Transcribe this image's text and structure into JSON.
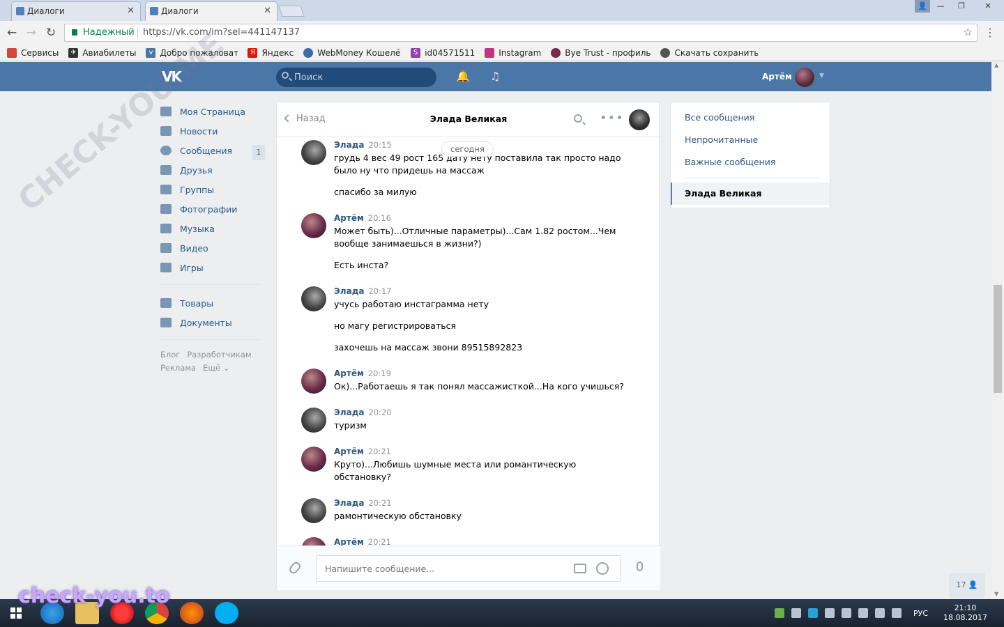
{
  "browser": {
    "tabs": [
      {
        "label": "Диалоги",
        "active": false
      },
      {
        "label": "Диалоги",
        "active": true
      }
    ],
    "secure_label": "Надежный",
    "url": "https://vk.com/im?sel=441147137",
    "bookmarks": [
      {
        "label": "Сервисы",
        "icon": "apps-grid-icon",
        "color": "#d14836"
      },
      {
        "label": "Авиабилеты",
        "icon": "plane-icon",
        "color": "#333333"
      },
      {
        "label": "Добро пожаловать",
        "icon": "vk-icon",
        "color": "#4a76a8"
      },
      {
        "label": "Яндекс",
        "icon": "yandex-icon",
        "color": "#e61400"
      },
      {
        "label": "WebMoney Кошелёк",
        "icon": "webmoney-icon",
        "color": "#3a6ea5"
      },
      {
        "label": "id04571511",
        "icon": "s-icon",
        "color": "#8e44ad"
      },
      {
        "label": "Instagram",
        "icon": "instagram-icon",
        "color": "#c13584"
      },
      {
        "label": "Bye Trust - профиль",
        "icon": "bye-trust-icon",
        "color": "#7a2a4a"
      },
      {
        "label": "Скачать сохранить с",
        "icon": "download-icon",
        "color": "#555555"
      }
    ]
  },
  "vk": {
    "header": {
      "search_placeholder": "Поиск",
      "username": "Артём"
    },
    "nav": [
      {
        "label": "Моя Страница",
        "icon": "home-icon"
      },
      {
        "label": "Новости",
        "icon": "news-icon"
      },
      {
        "label": "Сообщения",
        "icon": "messages-icon",
        "badge": "1"
      },
      {
        "label": "Друзья",
        "icon": "friends-icon"
      },
      {
        "label": "Группы",
        "icon": "groups-icon"
      },
      {
        "label": "Фотографии",
        "icon": "photos-icon"
      },
      {
        "label": "Музыка",
        "icon": "music-icon"
      },
      {
        "label": "Видео",
        "icon": "video-icon"
      },
      {
        "label": "Игры",
        "icon": "games-icon"
      },
      {
        "label": "Товары",
        "icon": "goods-icon"
      },
      {
        "label": "Документы",
        "icon": "documents-icon"
      }
    ],
    "footer": [
      "Блог",
      "Разработчикам",
      "Реклама",
      "Ещё ⌄"
    ],
    "chat": {
      "back_label": "Назад",
      "title": "Элада Великая",
      "date_divider": "сегодня",
      "messages": [
        {
          "author": "Элада",
          "time": "20:15",
          "lines": [
            "грудь 4 вес 49 рост 165 дату нету поставила так просто надо было ну что придешь на массаж",
            "спасибо за милую"
          ]
        },
        {
          "author": "Артём",
          "time": "20:16",
          "lines": [
            "Может быть)...Отличные параметры)...Сам 1.82 ростом...Чем вообще занимаешься в жизни?)",
            "Есть инста?"
          ]
        },
        {
          "author": "Элада",
          "time": "20:17",
          "lines": [
            "учусь работаю инстаграмма нету",
            "но магу регистрироваться",
            "захочешь на массаж звони 89515892823"
          ]
        },
        {
          "author": "Артём",
          "time": "20:19",
          "lines": [
            "Ок)...Работаешь я так понял массажисткой...На кого учишься?"
          ]
        },
        {
          "author": "Элада",
          "time": "20:20",
          "lines": [
            "туризм"
          ]
        },
        {
          "author": "Артём",
          "time": "20:21",
          "lines": [
            "Круто)...Любишь шумные места или романтическую обстановку?"
          ]
        },
        {
          "author": "Элада",
          "time": "20:21",
          "lines": [
            "рамонтическую обстановку"
          ]
        },
        {
          "author": "Артём",
          "time": "20:21",
          "lines": []
        }
      ],
      "compose_placeholder": "Напишите сообщение..."
    },
    "filters": [
      {
        "label": "Все сообщения",
        "selected": false
      },
      {
        "label": "Непрочитанные",
        "selected": false
      },
      {
        "label": "Важные сообщения",
        "selected": false
      },
      {
        "label": "Элада Великая",
        "selected": true
      }
    ],
    "online_count": "17"
  },
  "taskbar": {
    "language": "РУС",
    "time": "21:10",
    "date": "18.08.2017"
  },
  "watermarks": {
    "diagonal": "CHECK-YOU.ME",
    "bottom": "check-you.to"
  }
}
